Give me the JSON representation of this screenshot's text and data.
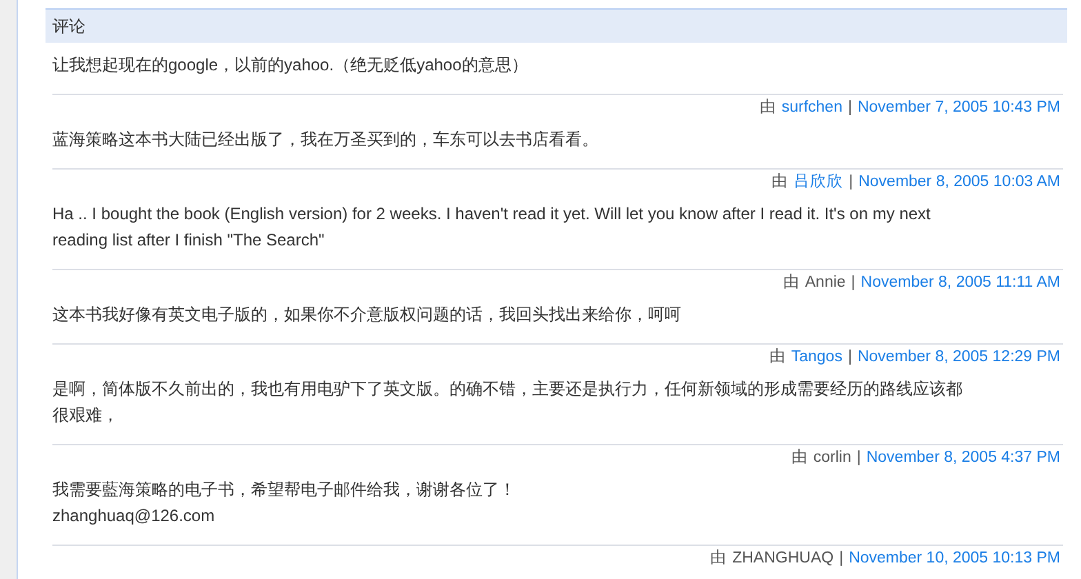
{
  "section": {
    "title": "评论"
  },
  "comments": [
    {
      "text": "让我想起现在的google，以前的yahoo.（绝无贬低yahoo的意思）",
      "by": "由",
      "author": "surfchen",
      "author_linked": true,
      "sep": "|",
      "date": "November 7, 2005 10:43 PM"
    },
    {
      "text": "蓝海策略这本书大陆已经出版了，我在万圣买到的，车东可以去书店看看。",
      "by": "由",
      "author": "吕欣欣",
      "author_linked": true,
      "sep": "|",
      "date": "November 8, 2005 10:03 AM"
    },
    {
      "text": "Ha .. I bought the book (English version) for 2 weeks. I haven't read it yet. Will let you know after I read it. It's on my next reading list after I finish \"The Search\"",
      "by": "由",
      "author": "Annie",
      "author_linked": false,
      "sep": "|",
      "date": "November 8, 2005 11:11 AM"
    },
    {
      "text": "这本书我好像有英文电子版的，如果你不介意版权问题的话，我回头找出来给你，呵呵",
      "by": "由",
      "author": "Tangos",
      "author_linked": true,
      "sep": "|",
      "date": "November 8, 2005 12:29 PM"
    },
    {
      "text": "是啊，简体版不久前出的，我也有用电驴下了英文版。的确不错，主要还是执行力，任何新领域的形成需要经历的路线应该都很艰难，",
      "by": "由",
      "author": "corlin",
      "author_linked": false,
      "sep": "|",
      "date": "November 8, 2005 4:37 PM"
    },
    {
      "text": "我需要藍海策略的电子书，希望帮电子邮件给我，谢谢各位了！\nzhanghuaq@126.com",
      "by": "由",
      "author": "ZHANGHUAQ",
      "author_linked": false,
      "sep": "|",
      "date": "November 10, 2005 10:13 PM"
    }
  ]
}
